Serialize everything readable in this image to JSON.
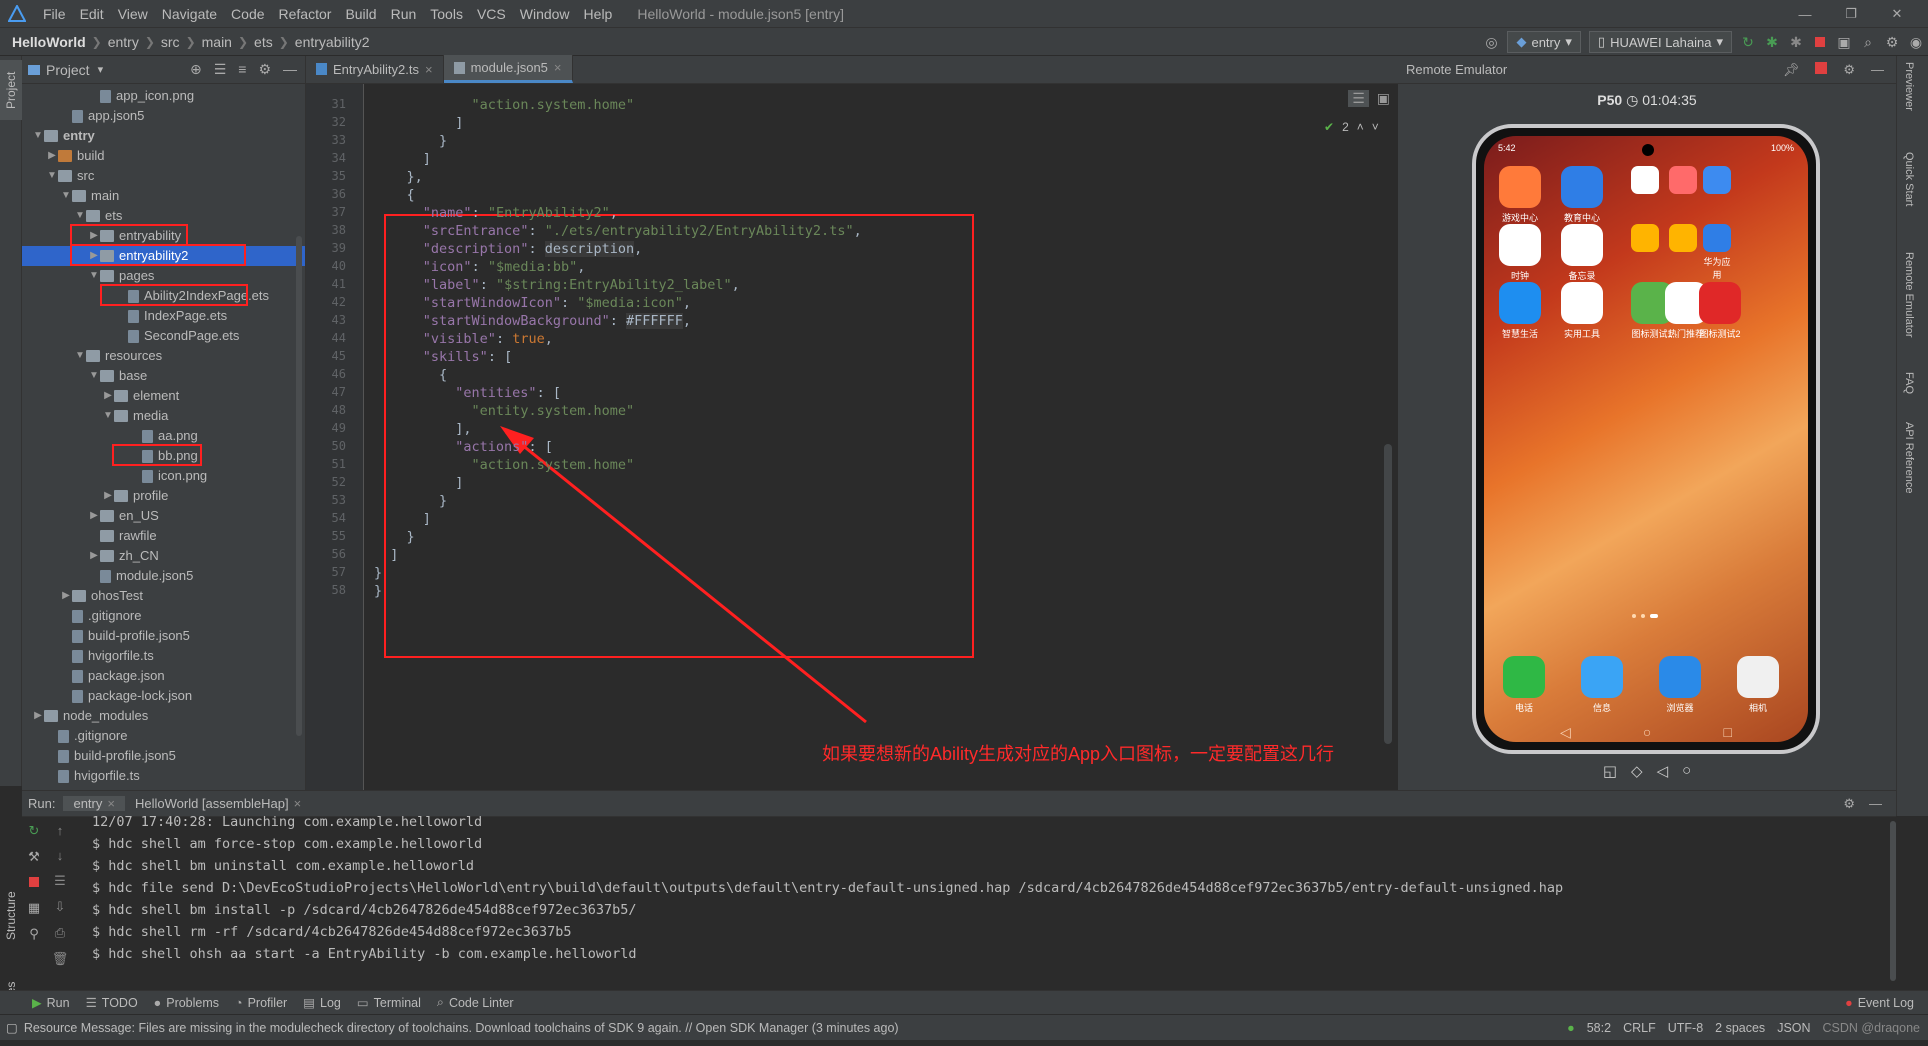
{
  "menubar": {
    "items": [
      "File",
      "Edit",
      "View",
      "Navigate",
      "Code",
      "Refactor",
      "Build",
      "Run",
      "Tools",
      "VCS",
      "Window",
      "Help"
    ],
    "window_title": "HelloWorld - module.json5 [entry]"
  },
  "breadcrumb": [
    "HelloWorld",
    "entry",
    "src",
    "main",
    "ets",
    "entryability2"
  ],
  "toolbar": {
    "module_config": "entry",
    "device": "HUAWEI Lahaina"
  },
  "left_strip": {
    "project_tab": "Project",
    "structure_tab": "Structure",
    "favorites_tab": "Favorites"
  },
  "project_panel": {
    "title": "Project",
    "tree": [
      {
        "label": "app_icon.png",
        "depth": 5,
        "kind": "file"
      },
      {
        "label": "app.json5",
        "depth": 3,
        "kind": "file"
      },
      {
        "label": "entry",
        "depth": 1,
        "kind": "folder",
        "bold": true,
        "open": true
      },
      {
        "label": "build",
        "depth": 2,
        "kind": "folder",
        "open": false
      },
      {
        "label": "src",
        "depth": 2,
        "kind": "folder",
        "open": true
      },
      {
        "label": "main",
        "depth": 3,
        "kind": "folder",
        "open": true
      },
      {
        "label": "ets",
        "depth": 4,
        "kind": "folder",
        "open": true
      },
      {
        "label": "entryability",
        "depth": 5,
        "kind": "folder",
        "open": false
      },
      {
        "label": "entryability2",
        "depth": 5,
        "kind": "folder",
        "open": false,
        "selected": true
      },
      {
        "label": "pages",
        "depth": 5,
        "kind": "folder",
        "open": true
      },
      {
        "label": "Ability2IndexPage.ets",
        "depth": 7,
        "kind": "file"
      },
      {
        "label": "IndexPage.ets",
        "depth": 7,
        "kind": "file"
      },
      {
        "label": "SecondPage.ets",
        "depth": 7,
        "kind": "file"
      },
      {
        "label": "resources",
        "depth": 4,
        "kind": "folder",
        "open": true
      },
      {
        "label": "base",
        "depth": 5,
        "kind": "folder",
        "open": true
      },
      {
        "label": "element",
        "depth": 6,
        "kind": "folder",
        "open": false
      },
      {
        "label": "media",
        "depth": 6,
        "kind": "folder",
        "open": true
      },
      {
        "label": "aa.png",
        "depth": 8,
        "kind": "file"
      },
      {
        "label": "bb.png",
        "depth": 8,
        "kind": "file"
      },
      {
        "label": "icon.png",
        "depth": 8,
        "kind": "file"
      },
      {
        "label": "profile",
        "depth": 6,
        "kind": "folder",
        "open": false
      },
      {
        "label": "en_US",
        "depth": 5,
        "kind": "folder",
        "open": false
      },
      {
        "label": "rawfile",
        "depth": 5,
        "kind": "folder"
      },
      {
        "label": "zh_CN",
        "depth": 5,
        "kind": "folder",
        "open": false
      },
      {
        "label": "module.json5",
        "depth": 5,
        "kind": "file"
      },
      {
        "label": "ohosTest",
        "depth": 3,
        "kind": "folder",
        "open": false
      },
      {
        "label": ".gitignore",
        "depth": 3,
        "kind": "file"
      },
      {
        "label": "build-profile.json5",
        "depth": 3,
        "kind": "file"
      },
      {
        "label": "hvigorfile.ts",
        "depth": 3,
        "kind": "file"
      },
      {
        "label": "package.json",
        "depth": 3,
        "kind": "file"
      },
      {
        "label": "package-lock.json",
        "depth": 3,
        "kind": "file"
      },
      {
        "label": "node_modules",
        "depth": 1,
        "kind": "folder",
        "open": false
      },
      {
        "label": ".gitignore",
        "depth": 2,
        "kind": "file"
      },
      {
        "label": "build-profile.json5",
        "depth": 2,
        "kind": "file"
      },
      {
        "label": "hvigorfile.ts",
        "depth": 2,
        "kind": "file"
      }
    ]
  },
  "editor": {
    "tabs": [
      {
        "label": "EntryAbility2.ts",
        "active": false
      },
      {
        "label": "module.json5",
        "active": true
      }
    ],
    "inspection_count": "2",
    "lines": [
      {
        "n": "31",
        "text": "            \"action.system.home\""
      },
      {
        "n": "32",
        "text": "          ]"
      },
      {
        "n": "33",
        "text": "        }"
      },
      {
        "n": "34",
        "text": "      ]"
      },
      {
        "n": "35",
        "text": "    },"
      },
      {
        "n": "36",
        "text": "    {"
      },
      {
        "n": "37",
        "text": "      \"name\": \"EntryAbility2\","
      },
      {
        "n": "38",
        "text": "      \"srcEntrance\": \"./ets/entryability2/EntryAbility2.ts\","
      },
      {
        "n": "39",
        "text": "      \"description\": description,"
      },
      {
        "n": "40",
        "text": "      \"icon\": \"$media:bb\","
      },
      {
        "n": "41",
        "text": "      \"label\": \"$string:EntryAbility2_label\","
      },
      {
        "n": "42",
        "text": "      \"startWindowIcon\": \"$media:icon\","
      },
      {
        "n": "43",
        "text": "      \"startWindowBackground\": #FFFFFF,"
      },
      {
        "n": "44",
        "text": "      \"visible\": true,"
      },
      {
        "n": "45",
        "text": "      \"skills\": ["
      },
      {
        "n": "46",
        "text": "        {"
      },
      {
        "n": "47",
        "text": "          \"entities\": ["
      },
      {
        "n": "48",
        "text": "            \"entity.system.home\""
      },
      {
        "n": "49",
        "text": "          ],"
      },
      {
        "n": "50",
        "text": "          \"actions\": ["
      },
      {
        "n": "51",
        "text": "            \"action.system.home\""
      },
      {
        "n": "52",
        "text": "          ]"
      },
      {
        "n": "53",
        "text": "        }"
      },
      {
        "n": "54",
        "text": "      ]"
      },
      {
        "n": "55",
        "text": "    }"
      },
      {
        "n": "56",
        "text": "  ]"
      },
      {
        "n": "57",
        "text": "}"
      },
      {
        "n": "58",
        "text": "}"
      }
    ],
    "annotation": "如果要想新的Ability生成对应的App入口图标，一定要配置这几行"
  },
  "emulator": {
    "title": "Remote Emulator",
    "device": "P50",
    "timer": "01:04:35",
    "status_time": "5:42",
    "battery": "100%",
    "apps": [
      {
        "label": "游戏中心",
        "color": "#ff7a3a"
      },
      {
        "label": "教育中心",
        "color": "#2f7ee6"
      },
      {
        "label": "",
        "color": "#ffffff"
      },
      {
        "label": "",
        "color": "#ff6a6a"
      },
      {
        "label": "",
        "color": "#3d8bf0"
      },
      {
        "label": "时钟",
        "color": "#ffffff"
      },
      {
        "label": "备忘录",
        "color": "#ffffff"
      },
      {
        "label": "",
        "color": "#ffb400"
      },
      {
        "label": "",
        "color": "#ffb400"
      },
      {
        "label": "华为应用",
        "color": "#2f7ee6"
      },
      {
        "label": "智慧生活",
        "color": "#1e8ef0"
      },
      {
        "label": "实用工具",
        "color": "#ffffff"
      },
      {
        "label": "图标测试1",
        "color": "#5ab34a"
      },
      {
        "label": "热门推荐",
        "color": "#ffffff"
      },
      {
        "label": "图标测试2",
        "color": "#e02828"
      }
    ],
    "dock": [
      {
        "label": "电话",
        "color": "#2fb845"
      },
      {
        "label": "信息",
        "color": "#3aa4f5"
      },
      {
        "label": "浏览器",
        "color": "#2a8ae8"
      },
      {
        "label": "相机",
        "color": "#f0f0f0"
      }
    ]
  },
  "run_panel": {
    "label": "Run:",
    "tabs": [
      "entry",
      "HelloWorld [assembleHap]"
    ],
    "console": [
      "12/07 17:40:28: Launching com.example.helloworld",
      "$ hdc shell am force-stop com.example.helloworld",
      "$ hdc shell bm uninstall com.example.helloworld",
      "$ hdc file send D:\\DevEcoStudioProjects\\HelloWorld\\entry\\build\\default\\outputs\\default\\entry-default-unsigned.hap /sdcard/4cb2647826de454d88cef972ec3637b5/entry-default-unsigned.hap",
      "$ hdc shell bm install -p /sdcard/4cb2647826de454d88cef972ec3637b5/",
      "$ hdc shell rm -rf /sdcard/4cb2647826de454d88cef972ec3637b5",
      "$ hdc shell ohsh aa start -a EntryAbility -b com.example.helloworld"
    ]
  },
  "tool_windows": [
    "Run",
    "TODO",
    "Problems",
    "Profiler",
    "Log",
    "Terminal",
    "Code Linter"
  ],
  "event_log": "Event Log",
  "right_strip": [
    "Previewer",
    "Quick Start",
    "Remote Emulator",
    "FAQ",
    "API Reference"
  ],
  "statusbar": {
    "message": "Resource Message: Files are missing in the modulecheck directory of toolchains. Download toolchains of SDK 9 again. // Open SDK Manager (3 minutes ago)",
    "position": "58:2",
    "line_sep": "CRLF",
    "encoding": "UTF-8",
    "indent": "2 spaces",
    "file_type": "JSON",
    "watermark": "CSDN @draqone"
  }
}
